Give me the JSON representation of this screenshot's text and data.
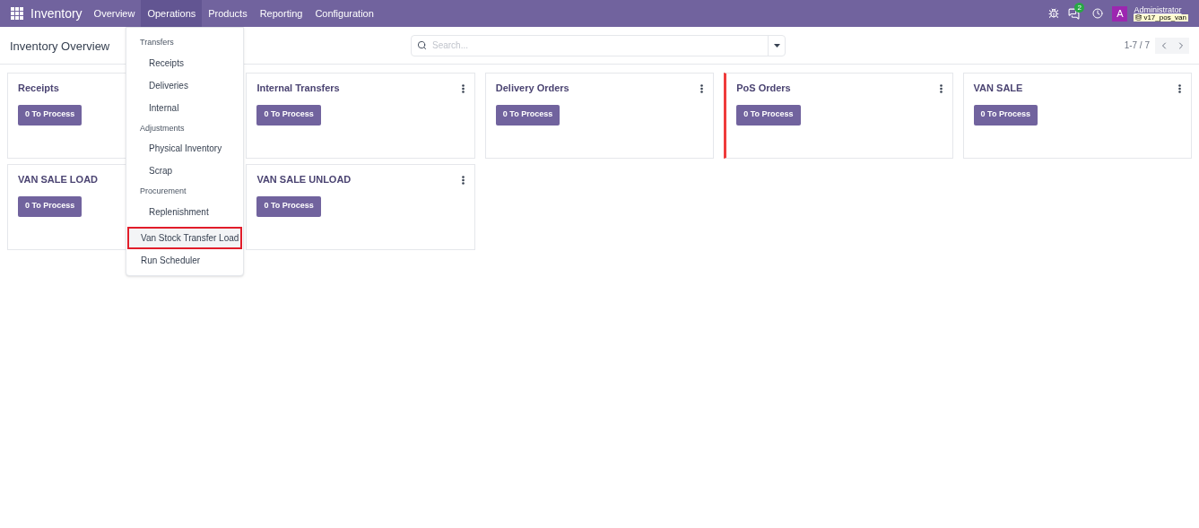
{
  "navbar": {
    "app_name": "Inventory",
    "items": [
      {
        "label": "Overview",
        "selected": false
      },
      {
        "label": "Operations",
        "selected": true
      },
      {
        "label": "Products",
        "selected": false
      },
      {
        "label": "Reporting",
        "selected": false
      },
      {
        "label": "Configuration",
        "selected": false
      }
    ],
    "chat_count": "2",
    "avatar_letter": "A",
    "user_name": "Administrator",
    "database": "v17_pos_van"
  },
  "control_panel": {
    "title": "Inventory Overview",
    "search": {
      "placeholder": "Search..."
    },
    "pager": "1-7 / 7"
  },
  "cards": [
    {
      "title": "Receipts",
      "button": "0 To Process",
      "flagged": false
    },
    {
      "title": "Internal Transfers",
      "button": "0 To Process",
      "flagged": false
    },
    {
      "title": "Delivery Orders",
      "button": "0 To Process",
      "flagged": false
    },
    {
      "title": "PoS Orders",
      "button": "0 To Process",
      "flagged": true
    },
    {
      "title": "VAN SALE",
      "button": "0 To Process",
      "flagged": false
    },
    {
      "title": "VAN SALE LOAD",
      "button": "0 To Process",
      "flagged": false
    },
    {
      "title": "VAN SALE UNLOAD",
      "button": "0 To Process",
      "flagged": false
    }
  ],
  "operations_menu": [
    {
      "kind": "section",
      "label": "Transfers",
      "children": [
        {
          "label": "Receipts",
          "highlighted": false
        },
        {
          "label": "Deliveries",
          "highlighted": false
        },
        {
          "label": "Internal",
          "highlighted": false
        }
      ]
    },
    {
      "kind": "section",
      "label": "Adjustments",
      "children": [
        {
          "label": "Physical Inventory",
          "highlighted": false
        },
        {
          "label": "Scrap",
          "highlighted": false
        }
      ]
    },
    {
      "kind": "section",
      "label": "Procurement",
      "children": [
        {
          "label": "Replenishment",
          "highlighted": false
        }
      ]
    },
    {
      "kind": "item",
      "label": "Van Stock Transfer Load",
      "highlighted": true
    },
    {
      "kind": "item",
      "label": "Run Scheduler",
      "highlighted": false
    }
  ]
}
